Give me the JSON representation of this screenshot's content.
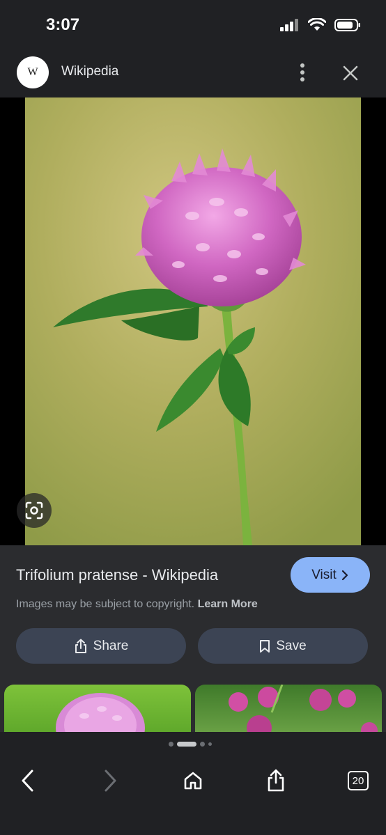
{
  "status_bar": {
    "time": "3:07"
  },
  "header": {
    "site_logo": "W",
    "site_name": "Wikipedia"
  },
  "result": {
    "title": "Trifolium pratense - Wikipedia",
    "visit_label": "Visit",
    "copyright_text": "Images may be subject to copyright.",
    "learn_more_label": "Learn More",
    "share_label": "Share",
    "save_label": "Save"
  },
  "bottom_bar": {
    "tab_count": "20"
  },
  "colors": {
    "background": "#202124",
    "panel": "#2b2c2f",
    "visit_button": "#8ab4f8",
    "pill_button": "#3c4454",
    "flower": "#c45bb8"
  },
  "icons": [
    "signal-icon",
    "wifi-icon",
    "battery-icon",
    "more-vert-icon",
    "close-icon",
    "lens-icon",
    "chevron-right-icon",
    "share-icon",
    "bookmark-icon",
    "back-icon",
    "forward-icon",
    "home-icon",
    "ios-share-icon",
    "tabs-icon"
  ]
}
